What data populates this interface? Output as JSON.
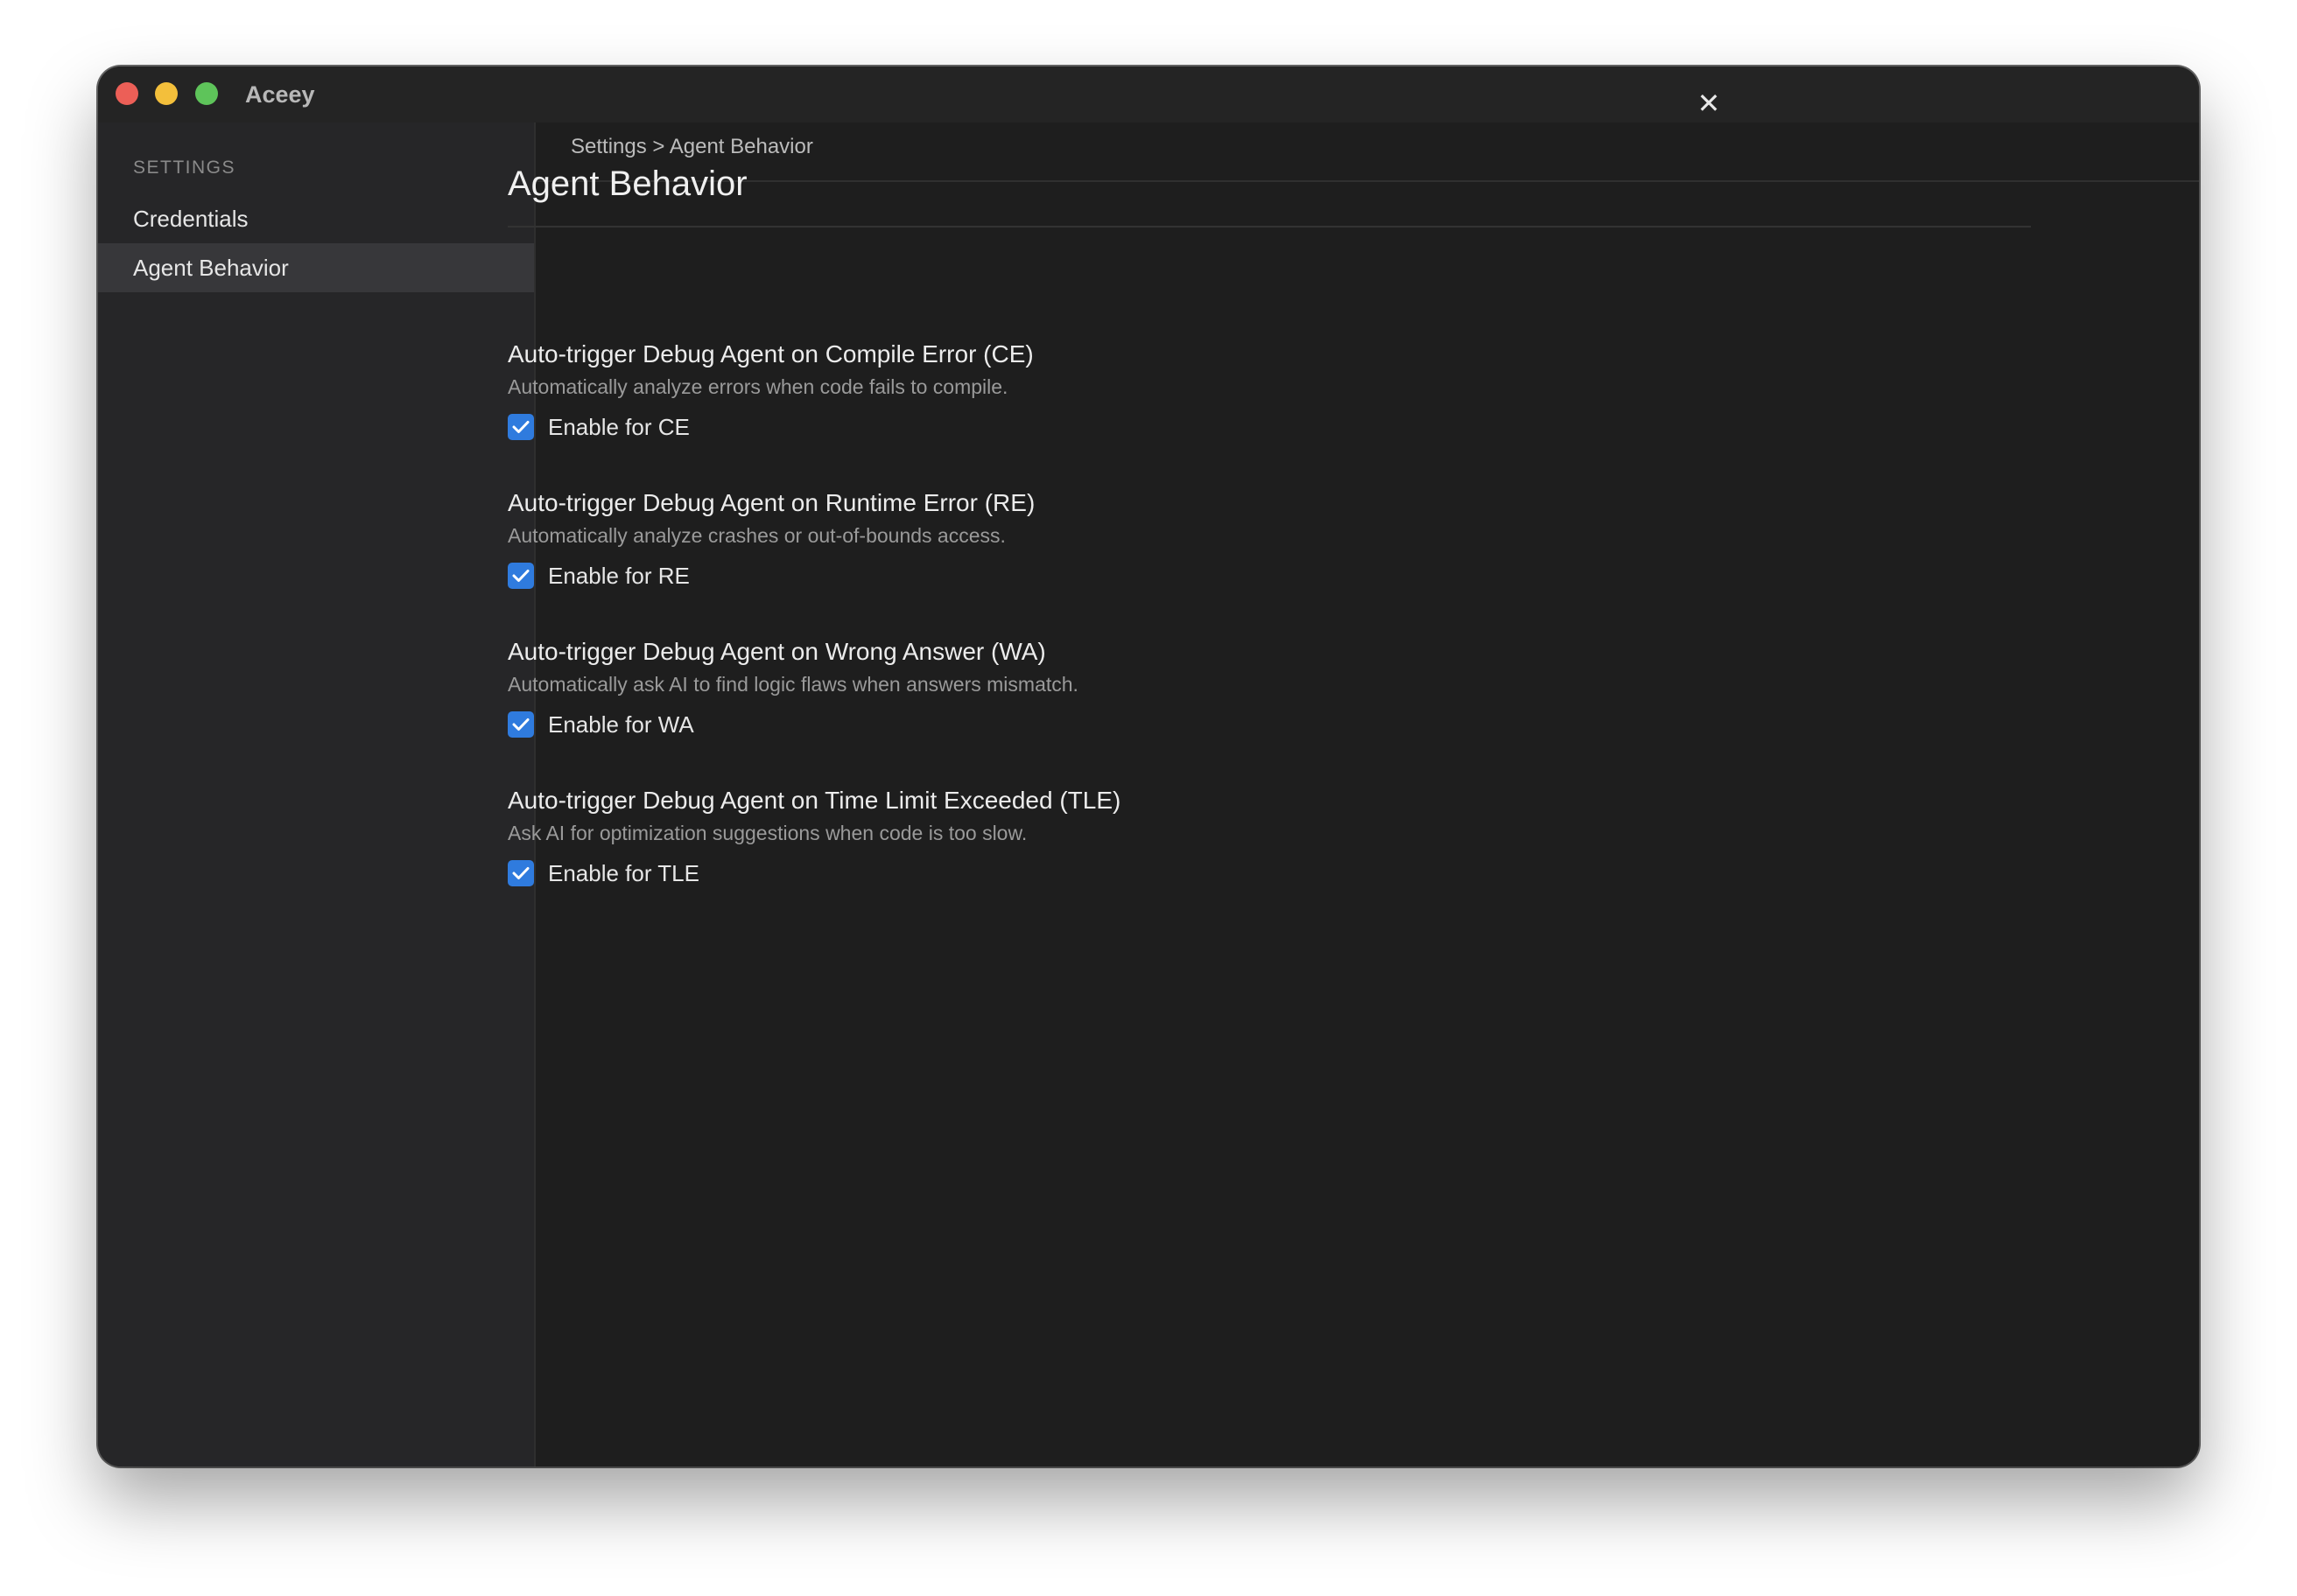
{
  "window": {
    "app_title": "Aceey"
  },
  "sidebar": {
    "heading": "SETTINGS",
    "items": [
      {
        "label": "Credentials",
        "selected": false
      },
      {
        "label": "Agent Behavior",
        "selected": true
      }
    ]
  },
  "main": {
    "breadcrumb": "Settings > Agent Behavior",
    "close_glyph": "✕",
    "page_title": "Agent Behavior",
    "options": [
      {
        "title": "Auto-trigger Debug Agent on Compile Error (CE)",
        "description": "Automatically analyze errors when code fails to compile.",
        "checkbox_label": "Enable for CE",
        "checked": true
      },
      {
        "title": "Auto-trigger Debug Agent on Runtime Error (RE)",
        "description": "Automatically analyze crashes or out-of-bounds access.",
        "checkbox_label": "Enable for RE",
        "checked": true
      },
      {
        "title": "Auto-trigger Debug Agent on Wrong Answer (WA)",
        "description": "Automatically ask AI to find logic flaws when answers mismatch.",
        "checkbox_label": "Enable for WA",
        "checked": true
      },
      {
        "title": "Auto-trigger Debug Agent on Time Limit Exceeded (TLE)",
        "description": "Ask AI for optimization suggestions when code is too slow.",
        "checkbox_label": "Enable for TLE",
        "checked": true
      }
    ]
  },
  "colors": {
    "accent": "#2f7bde",
    "window_bg": "#1e1e1e",
    "sidebar_bg": "#262628",
    "sidebar_selected_bg": "#37373a",
    "traffic_close": "#ec5f57",
    "traffic_minimize": "#f3bf3b",
    "traffic_maximize": "#5ec45a"
  },
  "icons": {
    "checkbox": "checkmark-icon",
    "close": "close-icon"
  }
}
